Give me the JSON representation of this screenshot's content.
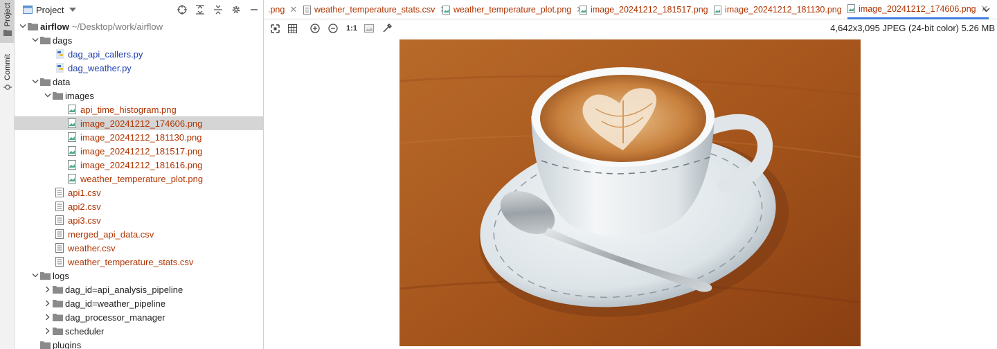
{
  "sidebar_strip": {
    "project_label": "Project",
    "commit_label": "Commit"
  },
  "panel": {
    "title": "Project"
  },
  "tree": {
    "root": {
      "name": "airflow",
      "path": "~/Desktop/work/airflow"
    },
    "dags": {
      "name": "dags",
      "items": [
        "dag_api_callers.py",
        "dag_weather.py"
      ]
    },
    "data": {
      "name": "data",
      "images": {
        "name": "images",
        "items": [
          "api_time_histogram.png",
          "image_20241212_174606.png",
          "image_20241212_181130.png",
          "image_20241212_181517.png",
          "image_20241212_181616.png",
          "weather_temperature_plot.png"
        ]
      },
      "files": [
        "api1.csv",
        "api2.csv",
        "api3.csv",
        "merged_api_data.csv",
        "weather.csv",
        "weather_temperature_stats.csv"
      ]
    },
    "logs": {
      "name": "logs",
      "items": [
        "dag_id=api_analysis_pipeline",
        "dag_id=weather_pipeline",
        "dag_processor_manager",
        "scheduler"
      ]
    },
    "plugins": {
      "name": "plugins"
    }
  },
  "tabs": [
    ".png",
    "weather_temperature_stats.csv",
    "weather_temperature_plot.png",
    "image_20241212_181517.png",
    "image_20241212_181130.png",
    "image_20241212_174606.png"
  ],
  "toolbar": {
    "zoom_actual": "1:1"
  },
  "image_info": "4,642x3,095 JPEG (24-bit color) 5.26 MB",
  "colors": {
    "modified_file": "#b03400",
    "python_file": "#2040b0",
    "active_tab_underline": "#3d7fe0",
    "selection": "#d5d5d5"
  },
  "icons": [
    "project-icon",
    "folder-icon",
    "python-file-icon",
    "image-file-icon",
    "text-file-icon",
    "crosshair-icon",
    "expand-all-icon",
    "collapse-all-icon",
    "gear-icon",
    "minimize-icon",
    "chevron-down-icon",
    "zoom-in-icon",
    "zoom-out-icon",
    "grid-icon",
    "fit-icon",
    "background-icon",
    "color-picker-icon"
  ]
}
